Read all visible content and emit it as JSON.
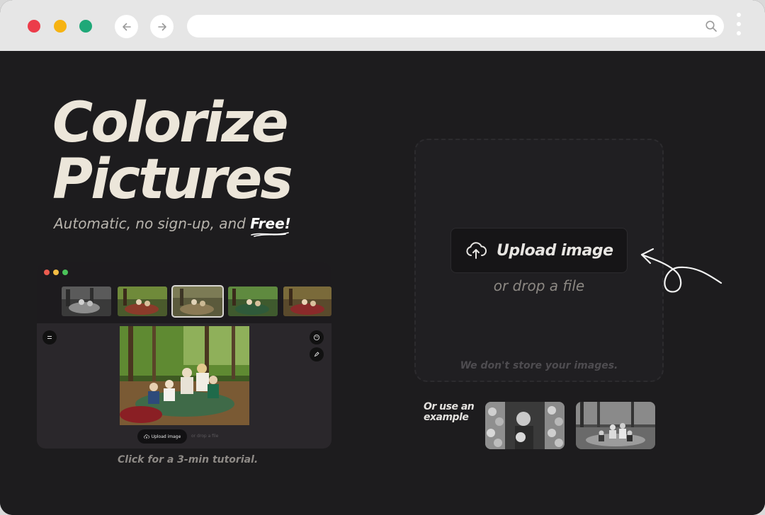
{
  "browser": {
    "back_icon": "arrow-left-icon",
    "forward_icon": "arrow-right-icon",
    "address_value": "",
    "search_icon": "search-icon",
    "menu_icon": "kebab-icon"
  },
  "hero": {
    "title_line1": "Colorize",
    "title_line2": "Pictures",
    "tagline_prefix": "Automatic, no sign-up, and ",
    "tagline_emphasis": "Free!"
  },
  "preview": {
    "upload_label": "Upload image",
    "drop_label": "or drop a file",
    "caption": "Click for a 3-min tutorial."
  },
  "uploader": {
    "upload_label": "Upload image",
    "drop_label": "or drop a file",
    "privacy_note": "We don't store your images."
  },
  "examples": {
    "label_line1": "Or use an",
    "label_line2": "example"
  },
  "colors": {
    "background": "#1d1c1e",
    "title": "#ece6da",
    "traffic_red": "#ec3c4a",
    "traffic_yellow": "#f6b312",
    "traffic_green": "#1fa878"
  }
}
